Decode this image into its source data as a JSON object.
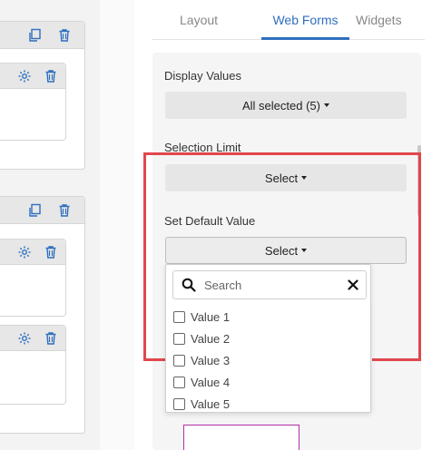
{
  "tabs": [
    {
      "label": "Layout",
      "active": false
    },
    {
      "label": "Web Forms",
      "active": true
    },
    {
      "label": "Widgets",
      "active": false
    }
  ],
  "fields": {
    "display_values": {
      "label": "Display Values",
      "value": "All selected (5)"
    },
    "selection_limit": {
      "label": "Selection Limit",
      "value": "Select"
    },
    "default_value": {
      "label": "Set Default Value",
      "value": "Select"
    }
  },
  "dropdown": {
    "search_placeholder": "Search",
    "options": [
      "Value 1",
      "Value 2",
      "Value 3",
      "Value 4",
      "Value 5"
    ]
  },
  "left_canvas": {
    "icons": [
      "copy-icon",
      "trash-icon",
      "gear-icon"
    ]
  },
  "colors": {
    "accent": "#2f6fbf",
    "highlight": "#e0474c",
    "panel_header": "#e7e7e7"
  }
}
